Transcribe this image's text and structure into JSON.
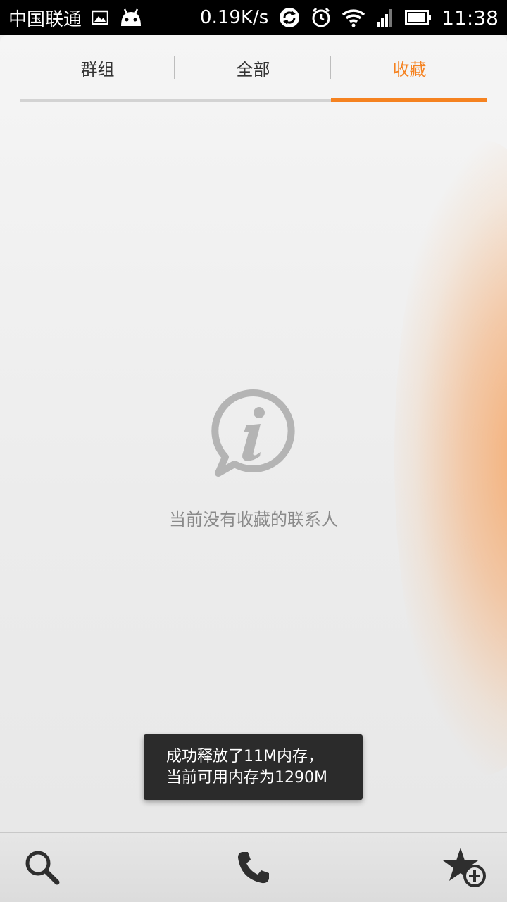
{
  "status_bar": {
    "carrier": "中国联通",
    "net_speed": "0.19K/s",
    "time": "11:38",
    "icons": [
      "gallery-icon",
      "android-icon",
      "sync-icon",
      "alarm-icon",
      "wifi-icon",
      "signal-icon",
      "battery-icon"
    ]
  },
  "tabs": [
    {
      "label": "群组",
      "active": false
    },
    {
      "label": "全部",
      "active": false
    },
    {
      "label": "收藏",
      "active": true
    }
  ],
  "empty_state": {
    "icon": "info-bubble-icon",
    "message": "当前没有收藏的联系人"
  },
  "toast": {
    "line1": "成功释放了11M内存，",
    "line2": "当前可用内存为1290M"
  },
  "bottom_bar": {
    "buttons": [
      "search-icon",
      "phone-icon",
      "add-favorite-icon"
    ]
  },
  "colors": {
    "accent": "#f58220",
    "background": "#eeeeee",
    "statusbar": "#000000",
    "toast": "#2b2b2b"
  }
}
